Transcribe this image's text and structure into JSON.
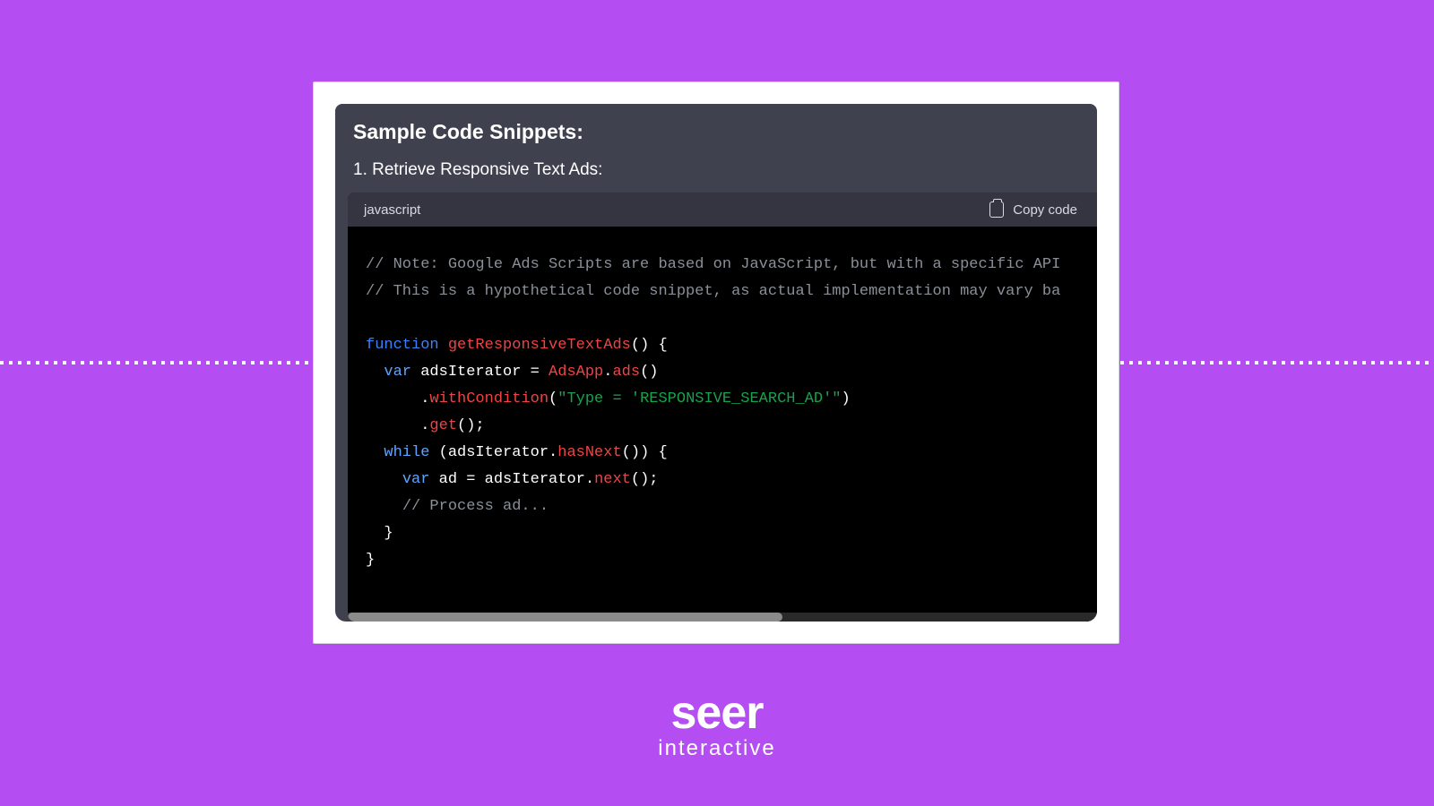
{
  "panel": {
    "title": "Sample Code Snippets:",
    "subtitle": "1. Retrieve Responsive Text Ads:"
  },
  "code_header": {
    "language": "javascript",
    "copy_label": "Copy code"
  },
  "code": {
    "lines": [
      {
        "tokens": [
          {
            "t": "// Note: Google Ads Scripts are based on JavaScript, but with a specific API",
            "cls": "c-comment"
          }
        ]
      },
      {
        "tokens": [
          {
            "t": "// This is a hypothetical code snippet, as actual implementation may vary ba",
            "cls": "c-comment"
          }
        ]
      },
      {
        "tokens": [
          {
            "t": "",
            "cls": "c-plain"
          }
        ]
      },
      {
        "tokens": [
          {
            "t": "function",
            "cls": "c-keyword"
          },
          {
            "t": " ",
            "cls": "c-plain"
          },
          {
            "t": "getResponsiveTextAds",
            "cls": "c-fn"
          },
          {
            "t": "() {",
            "cls": "c-plain"
          }
        ]
      },
      {
        "tokens": [
          {
            "t": "  ",
            "cls": "c-plain"
          },
          {
            "t": "var",
            "cls": "c-var"
          },
          {
            "t": " adsIterator = ",
            "cls": "c-plain"
          },
          {
            "t": "AdsApp",
            "cls": "c-fn"
          },
          {
            "t": ".",
            "cls": "c-plain"
          },
          {
            "t": "ads",
            "cls": "c-call"
          },
          {
            "t": "()",
            "cls": "c-plain"
          }
        ]
      },
      {
        "tokens": [
          {
            "t": "      .",
            "cls": "c-plain"
          },
          {
            "t": "withCondition",
            "cls": "c-call"
          },
          {
            "t": "(",
            "cls": "c-plain"
          },
          {
            "t": "\"Type = 'RESPONSIVE_SEARCH_AD'\"",
            "cls": "c-string"
          },
          {
            "t": ")",
            "cls": "c-plain"
          }
        ]
      },
      {
        "tokens": [
          {
            "t": "      .",
            "cls": "c-plain"
          },
          {
            "t": "get",
            "cls": "c-call"
          },
          {
            "t": "();",
            "cls": "c-plain"
          }
        ]
      },
      {
        "tokens": [
          {
            "t": "  ",
            "cls": "c-plain"
          },
          {
            "t": "while",
            "cls": "c-var"
          },
          {
            "t": " (adsIterator.",
            "cls": "c-plain"
          },
          {
            "t": "hasNext",
            "cls": "c-call"
          },
          {
            "t": "()) {",
            "cls": "c-plain"
          }
        ]
      },
      {
        "tokens": [
          {
            "t": "    ",
            "cls": "c-plain"
          },
          {
            "t": "var",
            "cls": "c-var"
          },
          {
            "t": " ad = adsIterator.",
            "cls": "c-plain"
          },
          {
            "t": "next",
            "cls": "c-call"
          },
          {
            "t": "();",
            "cls": "c-plain"
          }
        ]
      },
      {
        "tokens": [
          {
            "t": "    ",
            "cls": "c-plain"
          },
          {
            "t": "// Process ad...",
            "cls": "c-comment"
          }
        ]
      },
      {
        "tokens": [
          {
            "t": "  }",
            "cls": "c-plain"
          }
        ]
      },
      {
        "tokens": [
          {
            "t": "}",
            "cls": "c-plain"
          }
        ]
      }
    ]
  },
  "logo": {
    "top": "seer",
    "bottom": "interactive"
  }
}
